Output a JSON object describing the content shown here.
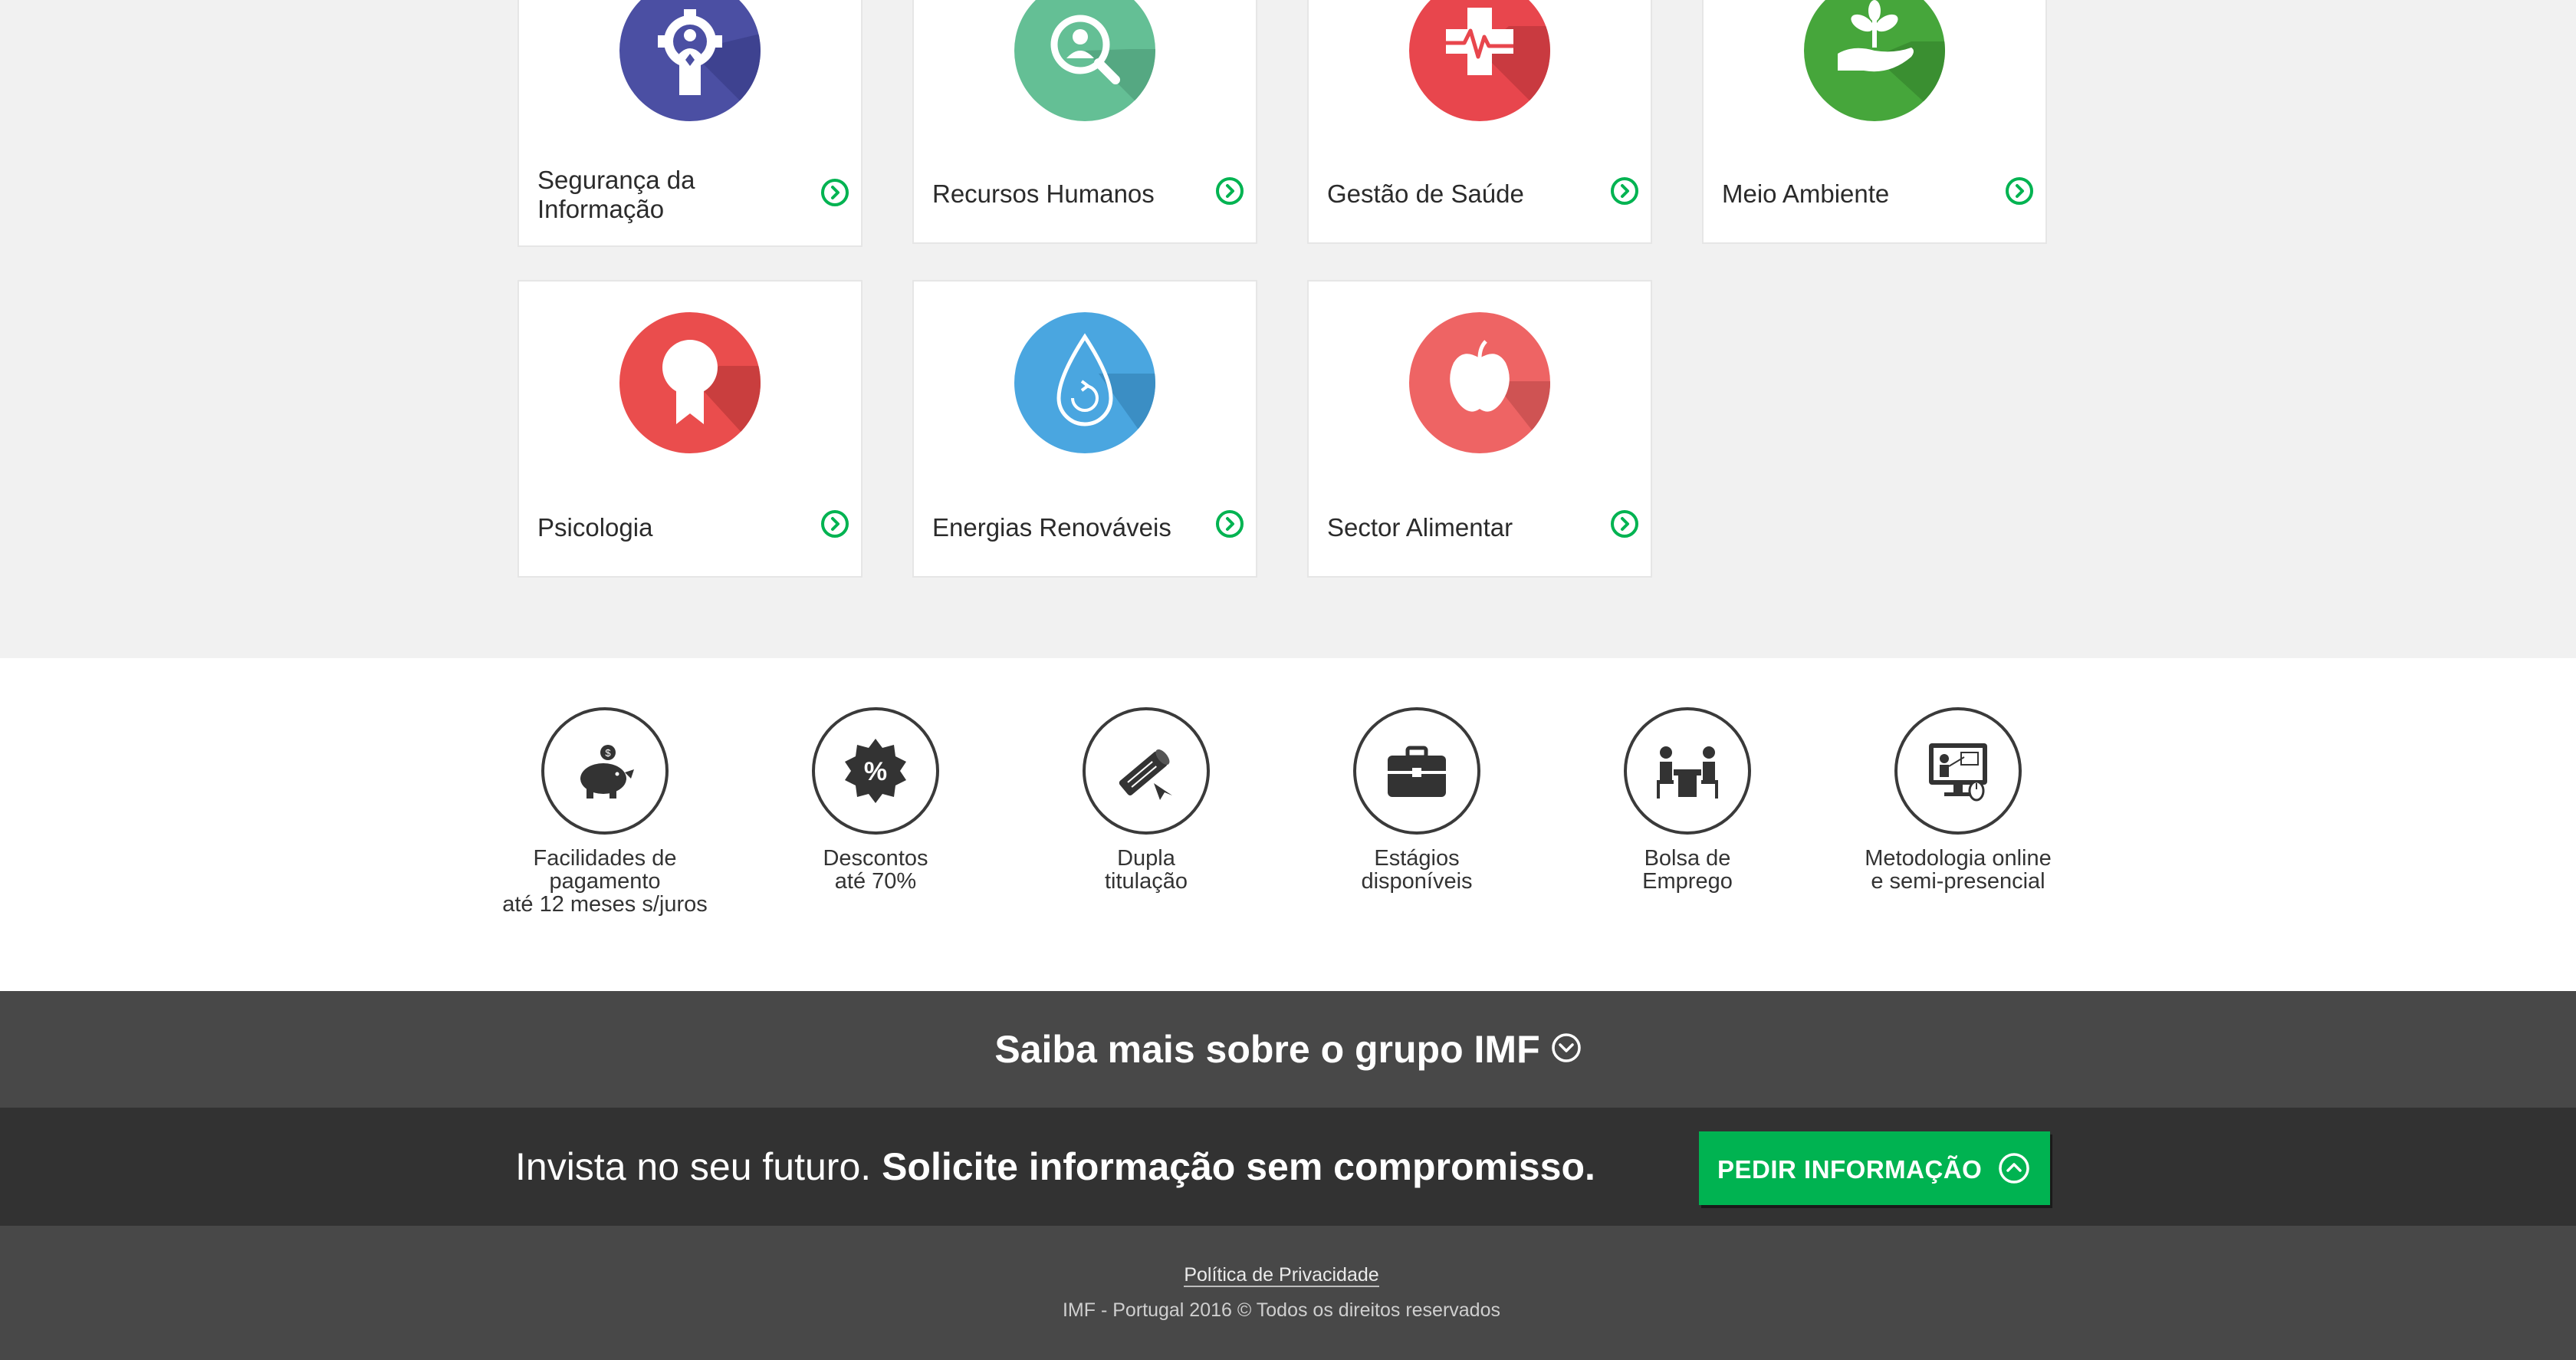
{
  "categories": [
    {
      "label": "Segurança da Informação",
      "icon": "user-gear-icon",
      "color": "#4b4fa3"
    },
    {
      "label": "Recursos Humanos",
      "icon": "magnifier-person-icon",
      "color": "#64bf95"
    },
    {
      "label": "Gestão de Saúde",
      "icon": "medical-cross-icon",
      "color": "#e8464d"
    },
    {
      "label": "Meio Ambiente",
      "icon": "plant-hand-icon",
      "color": "#46a63b"
    },
    {
      "label": "Psicologia",
      "icon": "award-ribbon-icon",
      "color": "#ea4d4d"
    },
    {
      "label": "Energias Renováveis",
      "icon": "water-drop-icon",
      "color": "#4aa6e0"
    },
    {
      "label": "Sector Alimentar",
      "icon": "apple-icon",
      "color": "#ee6464"
    }
  ],
  "benefits": [
    {
      "text": "Facilidades de\npagamento\naté 12 meses s/juros",
      "icon": "piggy-bank-icon"
    },
    {
      "text": "Descontos\naté 70%",
      "icon": "percent-badge-icon"
    },
    {
      "text": "Dupla\ntitulação",
      "icon": "diploma-icon"
    },
    {
      "text": "Estágios\ndisponíveis",
      "icon": "briefcase-icon"
    },
    {
      "text": "Bolsa de\nEmprego",
      "icon": "interview-icon"
    },
    {
      "text": "Metodologia online\ne semi-presencial",
      "icon": "online-class-icon"
    }
  ],
  "group_bar": {
    "title": "Saiba mais sobre o grupo IMF",
    "icon": "chevron-down-circle-icon"
  },
  "cta": {
    "text_regular": "Invista no seu futuro.",
    "text_bold": "Solicite informação sem compromisso.",
    "button_label": "PEDIR INFORMAÇÃO",
    "button_icon": "chevron-up-circle-icon"
  },
  "footer": {
    "privacy_link": "Política de Privacidade",
    "copyright": "IMF - Portugal 2016 © Todos os direitos reservados"
  },
  "colors": {
    "accent_green": "#00b351",
    "dark_bar": "#323232",
    "mid_bar": "#484848",
    "page_bg": "#f1f1f1"
  }
}
